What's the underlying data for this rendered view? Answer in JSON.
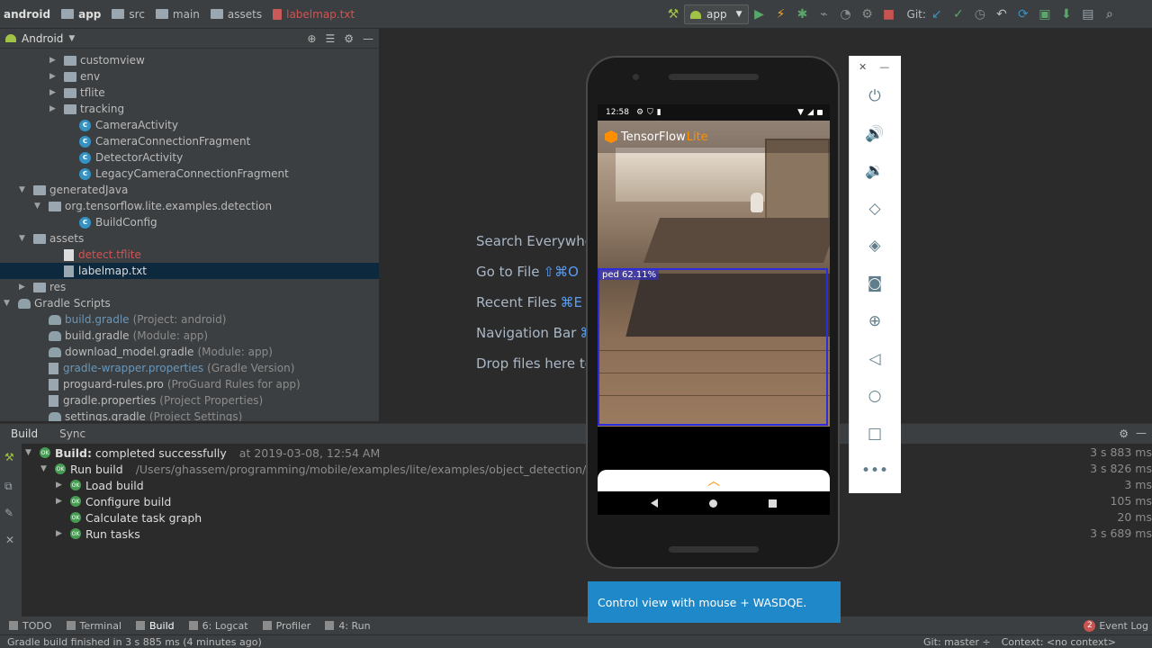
{
  "breadcrumbs": [
    "android",
    "app",
    "src",
    "main",
    "assets",
    "labelmap.txt"
  ],
  "toolbar": {
    "run_config": "app",
    "git_label": "Git:"
  },
  "project_panel": {
    "view": "Android",
    "tree": [
      {
        "label": "customview",
        "indent": 3,
        "type": "folder",
        "arrow": "▶"
      },
      {
        "label": "env",
        "indent": 3,
        "type": "folder",
        "arrow": "▶"
      },
      {
        "label": "tflite",
        "indent": 3,
        "type": "folder",
        "arrow": "▶"
      },
      {
        "label": "tracking",
        "indent": 3,
        "type": "folder",
        "arrow": "▶"
      },
      {
        "label": "CameraActivity",
        "indent": 4,
        "type": "class"
      },
      {
        "label": "CameraConnectionFragment",
        "indent": 4,
        "type": "class"
      },
      {
        "label": "DetectorActivity",
        "indent": 4,
        "type": "class"
      },
      {
        "label": "LegacyCameraConnectionFragment",
        "indent": 4,
        "type": "class"
      },
      {
        "label": "generatedJava",
        "indent": 1,
        "type": "folder",
        "arrow": "▼"
      },
      {
        "label": "org.tensorflow.lite.examples.detection",
        "indent": 2,
        "type": "folder",
        "arrow": "▼"
      },
      {
        "label": "BuildConfig",
        "indent": 4,
        "type": "class"
      },
      {
        "label": "assets",
        "indent": 1,
        "type": "folder",
        "arrow": "▼"
      },
      {
        "label": "detect.tflite",
        "indent": 3,
        "type": "file-red"
      },
      {
        "label": "labelmap.txt",
        "indent": 3,
        "type": "text",
        "selected": true
      },
      {
        "label": "res",
        "indent": 1,
        "type": "folder",
        "arrow": "▶"
      },
      {
        "label": "Gradle Scripts",
        "indent": 0,
        "type": "gradle-root",
        "arrow": "▼"
      },
      {
        "label": "build.gradle",
        "hint": "(Project: android)",
        "indent": 2,
        "type": "gradle",
        "blue": true
      },
      {
        "label": "build.gradle",
        "hint": "(Module: app)",
        "indent": 2,
        "type": "gradle"
      },
      {
        "label": "download_model.gradle",
        "hint": "(Module: app)",
        "indent": 2,
        "type": "gradle"
      },
      {
        "label": "gradle-wrapper.properties",
        "hint": "(Gradle Version)",
        "indent": 2,
        "type": "props",
        "blue": true
      },
      {
        "label": "proguard-rules.pro",
        "hint": "(ProGuard Rules for app)",
        "indent": 2,
        "type": "props"
      },
      {
        "label": "gradle.properties",
        "hint": "(Project Properties)",
        "indent": 2,
        "type": "props"
      },
      {
        "label": "settings.gradle",
        "hint": "(Project Settings)",
        "indent": 2,
        "type": "gradle"
      }
    ]
  },
  "editor_hints": [
    {
      "label": "Search Everywhe",
      "key": ""
    },
    {
      "label": "Go to File",
      "key": "⇧⌘O"
    },
    {
      "label": "Recent Files",
      "key": "⌘E"
    },
    {
      "label": "Navigation Bar",
      "key": "⌘"
    },
    {
      "label": "Drop files here to",
      "key": ""
    }
  ],
  "build_panel": {
    "tabs": [
      "Build",
      "Sync"
    ],
    "rows": [
      {
        "arrow": "▼",
        "indent": 0,
        "bold": "Build:",
        "label": " completed successfully",
        "extra": "at 2019-03-08, 12:54 AM",
        "time": "3 s 883 ms"
      },
      {
        "arrow": "▼",
        "indent": 1,
        "bold": "",
        "label": "Run build",
        "extra": "/Users/ghassem/programming/mobile/examples/lite/examples/object_detection/android",
        "time": "3 s 826 ms"
      },
      {
        "arrow": "▶",
        "indent": 2,
        "bold": "",
        "label": "Load build",
        "extra": "",
        "time": "3 ms"
      },
      {
        "arrow": "▶",
        "indent": 2,
        "bold": "",
        "label": "Configure build",
        "extra": "",
        "time": "105 ms"
      },
      {
        "arrow": "",
        "indent": 2,
        "bold": "",
        "label": "Calculate task graph",
        "extra": "",
        "time": "20 ms"
      },
      {
        "arrow": "▶",
        "indent": 2,
        "bold": "",
        "label": "Run tasks",
        "extra": "",
        "time": "3 s 689 ms"
      }
    ],
    "ok_badge": "OK"
  },
  "tool_windows": [
    {
      "label": "TODO"
    },
    {
      "label": "Terminal"
    },
    {
      "label": "Build",
      "active": true
    },
    {
      "label": "6: Logcat"
    },
    {
      "label": "Profiler"
    },
    {
      "label": "4: Run"
    }
  ],
  "event_log": {
    "count": "2",
    "label": "Event Log"
  },
  "status_bar": {
    "message": "Gradle build finished in 3 s 885 ms (4 minutes ago)",
    "git": "Git: master ÷",
    "context": "Context: <no context>"
  },
  "emulator": {
    "time": "12:58",
    "app_name": "TensorFlow",
    "app_suffix": "Lite",
    "detection_label": "bed 62.11%",
    "detection_visible": "ped 62.11%",
    "tooltip": "Control view with mouse + WASDQE."
  },
  "icons": {
    "run": "run-icon",
    "debug": "debug-icon",
    "power": "power-icon",
    "volume_up": "volume-up-icon",
    "volume_down": "volume-down-icon",
    "rotate_left": "rotate-left-icon",
    "rotate_right": "rotate-right-icon",
    "screenshot": "camera-icon",
    "zoom": "zoom-icon",
    "back": "back-icon",
    "home": "home-icon",
    "overview": "overview-icon",
    "more": "more-icon"
  },
  "colors": {
    "ide_bg": "#2b2b2b",
    "panel_bg": "#3c3f41",
    "selection": "#0d293e",
    "ok_green": "#499c54",
    "tooltip_blue": "#1e88c9",
    "tf_orange": "#ff8f00",
    "detection_box": "#2c2cdc"
  }
}
